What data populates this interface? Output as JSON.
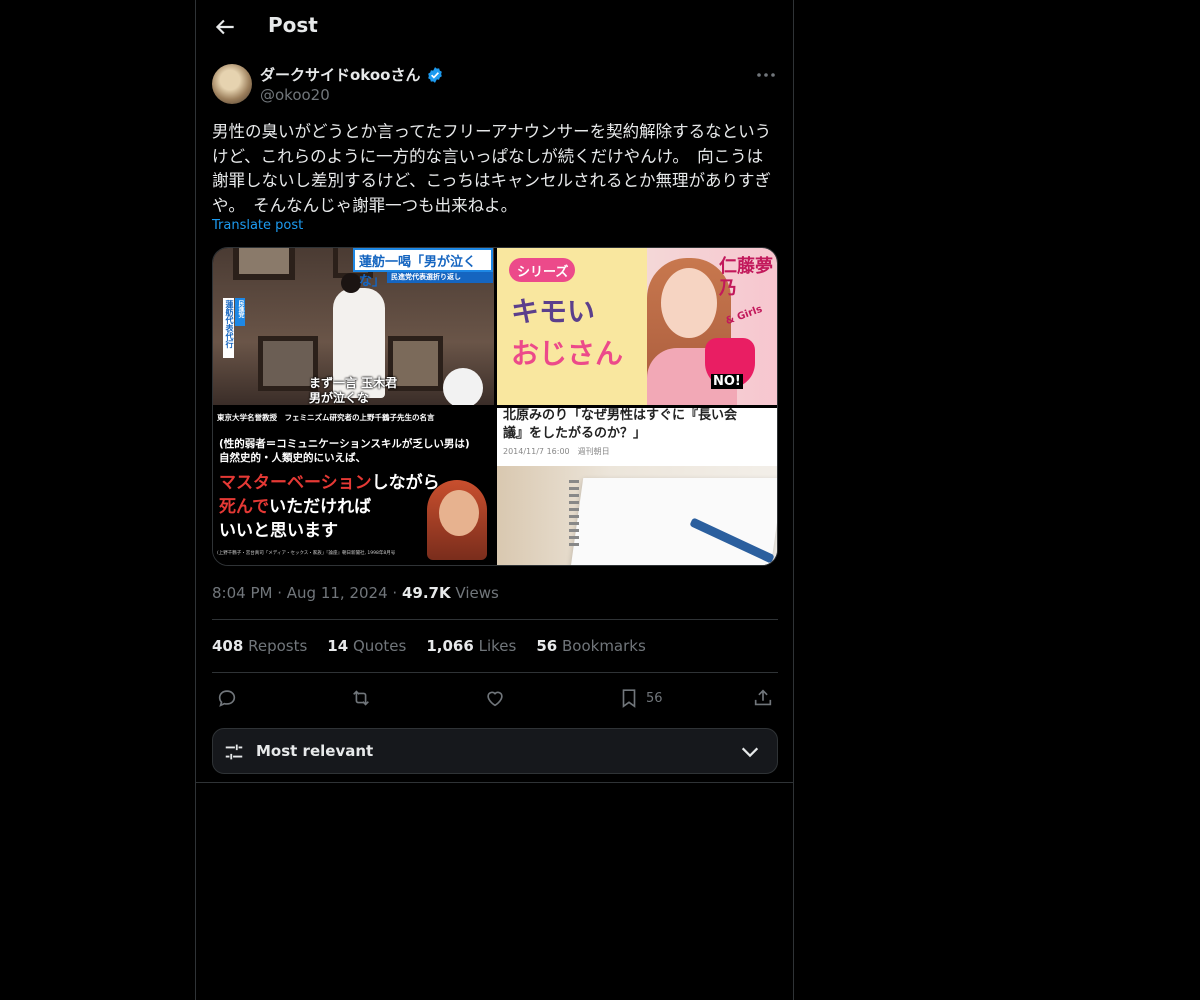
{
  "header": {
    "title": "Post"
  },
  "author": {
    "name": "ダークサイドokooさん",
    "handle": "@okoo20"
  },
  "post": {
    "text": "男性の臭いがどうとか言ってたフリーアナウンサーを契約解除するなというけど、これらのように一方的な言いっぱなしが続くだけやんけ。　向こうは謝罪しないし差別するけど、こっちはキャンセルされるとか無理がありすぎや。　そんなんじゃ謝罪一つも出来ねよ。",
    "translate_label": "Translate post",
    "time": "8:04 PM",
    "date": "Aug 11, 2024",
    "views_count": "49.7K",
    "views_label": "Views"
  },
  "media": {
    "img1": {
      "caption_top": "蓮舫一喝「男が泣くな」",
      "caption_sub": "民進党代表選折り返し",
      "side": "蓮舫代表代行",
      "side2": "民進党",
      "bottom1": "まず一言 玉木君",
      "bottom2": "男が泣くな"
    },
    "img2": {
      "tag": "シリーズ",
      "line1": "キモい",
      "line2": "おじさん",
      "name": "仁藤夢乃",
      "sub": "& Girls",
      "no": "NO!"
    },
    "img3": {
      "header": "東京大学名誉教授　フェミニズム研究者の上野千鶴子先生の名言",
      "line1": "(性的弱者＝コミュニケーションスキルが乏しい男は)",
      "line2": "自然史的・人類史的にいえば、",
      "line3a": "マスターベーション",
      "line3b": "しながら",
      "line4a": "死んで",
      "line4b": "いただければ",
      "line5": "いいと思います",
      "source": "(上野千鶴子・宮台真司「メディア・セックス・家族」『論座』朝日新聞社, 1998年8月号"
    },
    "img4": {
      "title1": "北原みのり「なぜ男性はすぐに『長い会",
      "title2": "議』をしたがるのか？」",
      "meta": "2014/11/7 16:00　週刊朝日"
    }
  },
  "counts": {
    "reposts": {
      "value": "408",
      "label": "Reposts"
    },
    "quotes": {
      "value": "14",
      "label": "Quotes"
    },
    "likes": {
      "value": "1,066",
      "label": "Likes"
    },
    "bookmarks": {
      "value": "56",
      "label": "Bookmarks"
    }
  },
  "actions": {
    "bookmark_count": "56"
  },
  "sort": {
    "label": "Most relevant"
  },
  "colors": {
    "accent": "#1d9bf0",
    "muted": "#71767b",
    "text": "#e7e9ea",
    "red": "#e53935"
  },
  "icons": [
    "back-arrow-icon",
    "verified-badge-icon",
    "more-icon",
    "reply-icon",
    "repost-icon",
    "like-icon",
    "bookmark-icon",
    "share-icon",
    "filter-icon",
    "chevron-down-icon"
  ]
}
